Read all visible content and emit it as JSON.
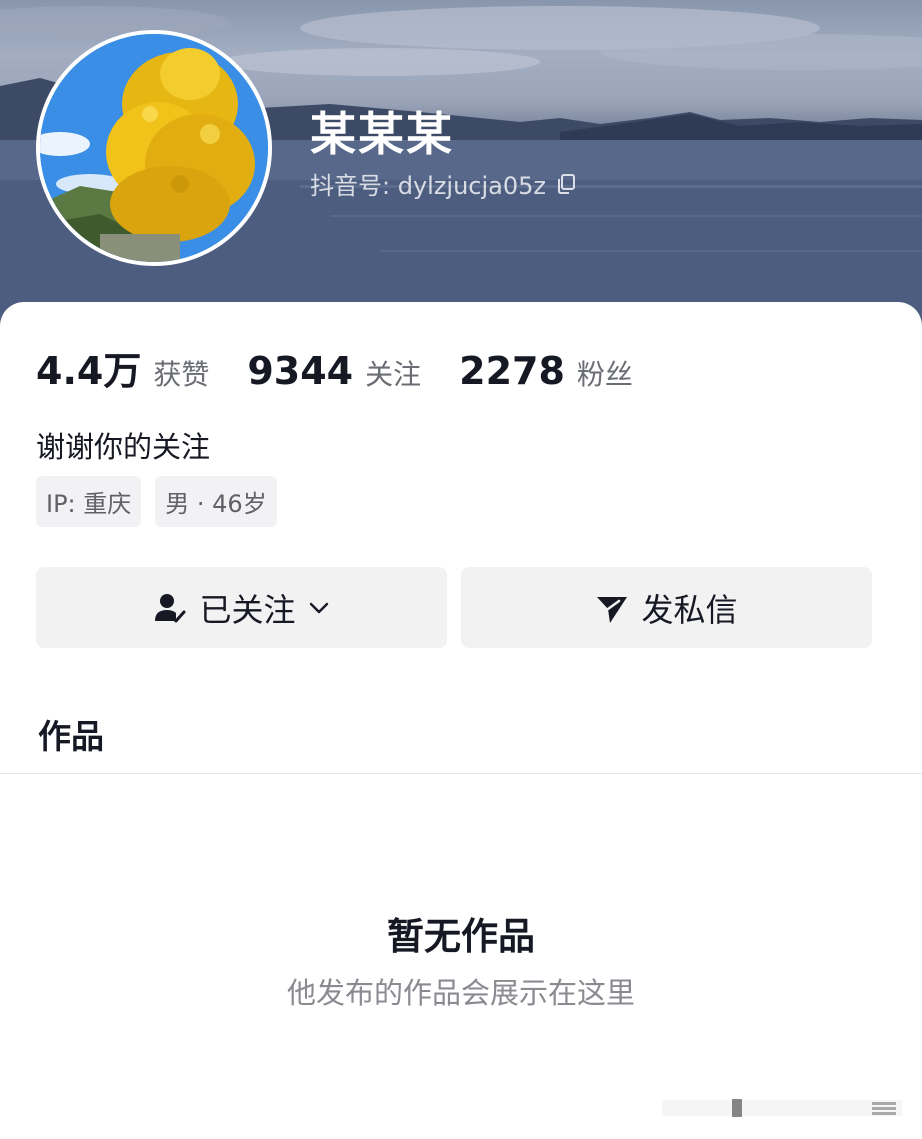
{
  "profile": {
    "nickname": "某某某",
    "douyin_id": "抖音号: dylzjucja05z",
    "bio": "谢谢你的关注"
  },
  "stats": [
    {
      "value": "4.4万",
      "label": "获赞"
    },
    {
      "value": "9344",
      "label": "关注"
    },
    {
      "value": "2278",
      "label": "粉丝"
    }
  ],
  "tags": [
    "IP: 重庆",
    "男 · 46岁"
  ],
  "actions": {
    "follow_label": "已关注",
    "message_label": "发私信"
  },
  "tabs": {
    "works_label": "作品"
  },
  "empty_state": {
    "title": "暂无作品",
    "subtitle": "他发布的作品会展示在这里"
  },
  "icons": {
    "copy": "copy-icon",
    "follow": "user-check-icon",
    "dropdown": "chevron-down-icon",
    "message": "paper-plane-icon"
  },
  "colors": {
    "text_primary": "#161823",
    "text_secondary": "#6b6d75",
    "button_bg": "#f2f2f2",
    "tag_bg": "#f2f2f4"
  }
}
